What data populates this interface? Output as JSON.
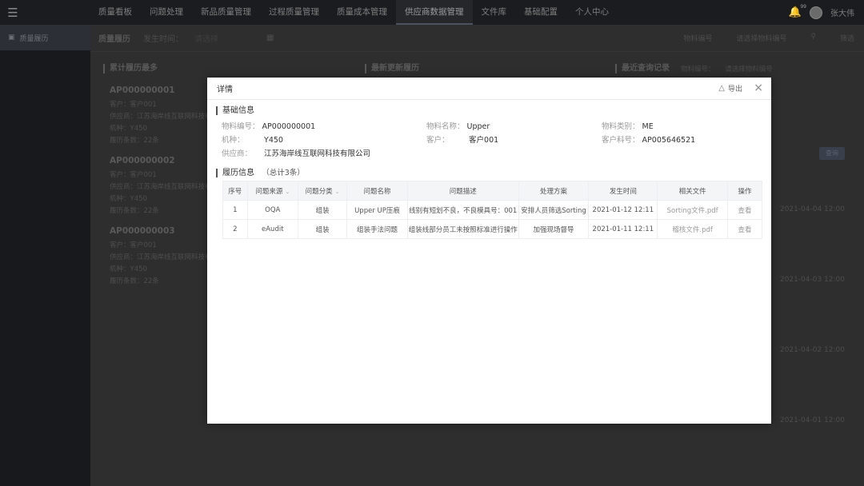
{
  "topbar": {
    "menu_icon": "hamburger-icon",
    "nav": [
      "质量看板",
      "问题处理",
      "新品质量管理",
      "过程质量管理",
      "质量成本管理",
      "供应商数据管理",
      "文件库",
      "基础配置",
      "个人中心"
    ],
    "active_index": 5,
    "bell_badge": "99",
    "username": "张大伟"
  },
  "sidebar": {
    "items": [
      {
        "label": "质量履历",
        "icon": "cube-icon"
      }
    ]
  },
  "main": {
    "title": "质量履历",
    "filter_label": "发生时间：",
    "filter_placeholder": "请选择",
    "material_label": "物料编号",
    "material_placeholder": "请选择物料编号",
    "filter_button": "筛选",
    "col_titles": [
      "累计履历最多",
      "最新更新履历",
      "最近查询记录"
    ],
    "cards": [
      {
        "code": "AP000000001",
        "customer": "客户：客户001",
        "supplier": "供应商：江苏海岸线互联网科技有限公司",
        "model": "机种：Y450",
        "count": "履历条数：22条"
      },
      {
        "code": "AP000000002",
        "customer": "客户：客户001",
        "supplier": "供应商：江苏海岸线互联网科技有限公司",
        "model": "机种：Y450",
        "count": "履历条数：22条"
      },
      {
        "code": "AP000000003",
        "customer": "客户：客户001",
        "supplier": "供应商：江苏海岸线互联网科技有限公司",
        "model": "机种：Y450",
        "count": "履历条数：22条"
      }
    ],
    "right_panel": {
      "row1": "物料编号：",
      "row1_val": "请选择物料编号"
    },
    "search_button": "查询",
    "dates": [
      "2021-04-04 12:00",
      "2021-04-03 12:00",
      "2021-04-02 12:00",
      "2021-04-01 12:00"
    ]
  },
  "modal": {
    "title": "详情",
    "export_label": "导出",
    "base_title": "基础信息",
    "info": {
      "material_no_label": "物料编号：",
      "material_no": "AP000000001",
      "material_name_label": "物料名称：",
      "material_name": "Upper",
      "material_type_label": "物料类别：",
      "material_type": "ME",
      "model_label": "机种：",
      "model": "Y450",
      "customer_label": "客户：",
      "customer": "客户001",
      "customer_pn_label": "客户料号：",
      "customer_pn": "AP005646521",
      "supplier_label": "供应商：",
      "supplier": "江苏海岸线互联网科技有限公司"
    },
    "history_title": "履历信息",
    "history_count": "（总计3条）",
    "table": {
      "headers": [
        "序号",
        "问题来源",
        "问题分类",
        "问题名称",
        "问题描述",
        "处理方案",
        "发生时间",
        "相关文件",
        "操作"
      ],
      "rows": [
        [
          "1",
          "OQA",
          "组装",
          "Upper UP压痕",
          "线别有短划不良，不良模具号：001",
          "安排人员筛选Sorting",
          "2021-01-12 12:11",
          "Sorting文件.pdf",
          "查看"
        ],
        [
          "2",
          "eAudit",
          "组装",
          "组装手法问题",
          "组装线部分员工未按照标准进行操作",
          "加强现场督导",
          "2021-01-11 12:11",
          "稽核文件.pdf",
          "查看"
        ]
      ]
    }
  }
}
